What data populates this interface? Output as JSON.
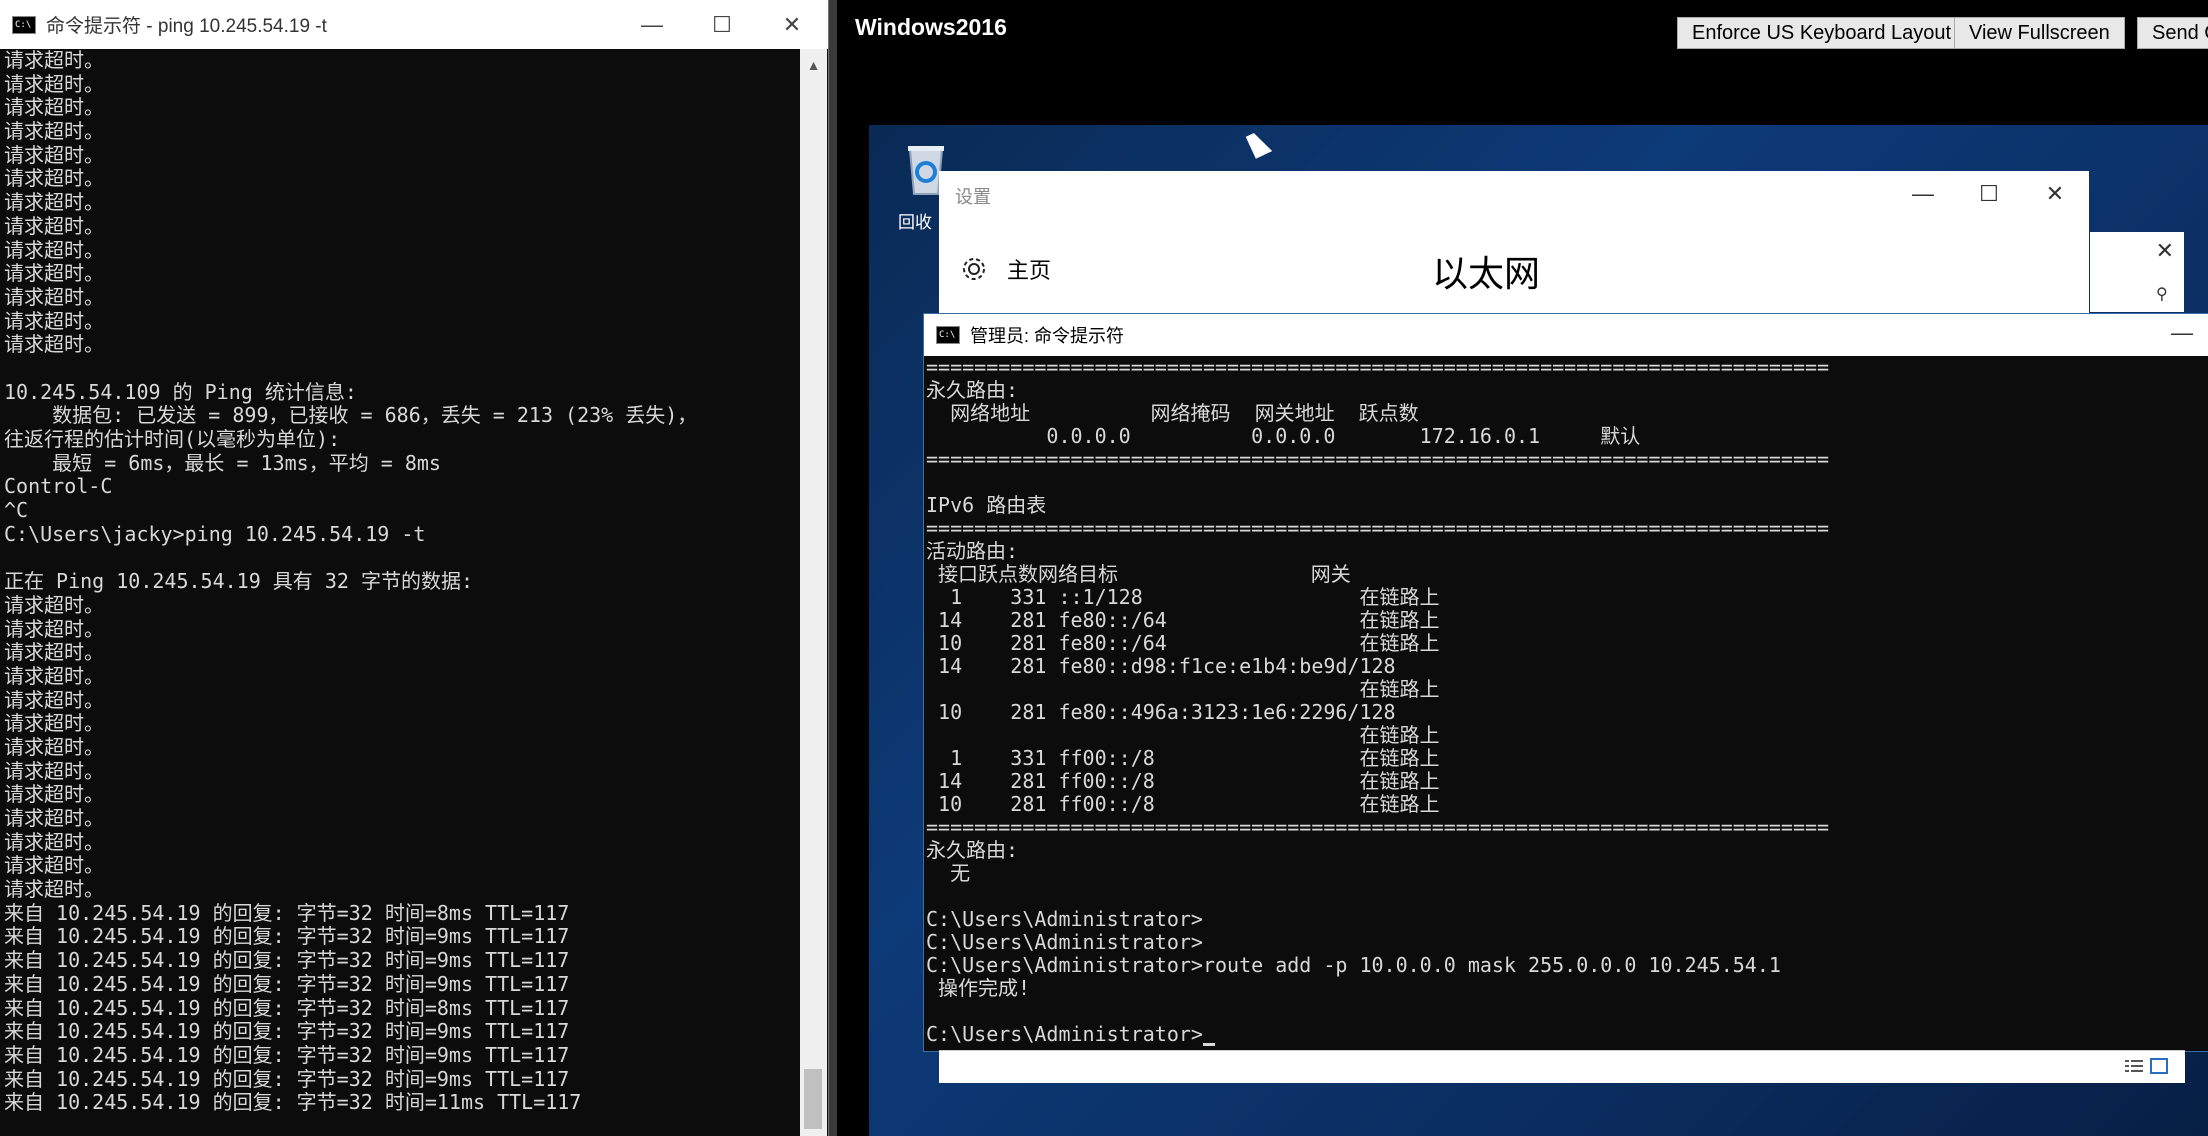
{
  "left_window": {
    "title": "命令提示符 - ping  10.245.54.19 -t",
    "icon_text": "C:\\",
    "controls": {
      "minimize": "—",
      "maximize": "☐",
      "close": "✕"
    },
    "lines": [
      "请求超时。",
      "请求超时。",
      "请求超时。",
      "请求超时。",
      "请求超时。",
      "请求超时。",
      "请求超时。",
      "请求超时。",
      "请求超时。",
      "请求超时。",
      "请求超时。",
      "请求超时。",
      "请求超时。",
      "",
      "10.245.54.109 的 Ping 统计信息:",
      "    数据包: 已发送 = 899，已接收 = 686，丢失 = 213 (23% 丢失)，",
      "往返行程的估计时间(以毫秒为单位):",
      "    最短 = 6ms，最长 = 13ms，平均 = 8ms",
      "Control-C",
      "^C",
      "C:\\Users\\jacky>ping 10.245.54.19 -t",
      "",
      "正在 Ping 10.245.54.19 具有 32 字节的数据:",
      "请求超时。",
      "请求超时。",
      "请求超时。",
      "请求超时。",
      "请求超时。",
      "请求超时。",
      "请求超时。",
      "请求超时。",
      "请求超时。",
      "请求超时。",
      "请求超时。",
      "请求超时。",
      "请求超时。",
      "来自 10.245.54.19 的回复: 字节=32 时间=8ms TTL=117",
      "来自 10.245.54.19 的回复: 字节=32 时间=9ms TTL=117",
      "来自 10.245.54.19 的回复: 字节=32 时间=9ms TTL=117",
      "来自 10.245.54.19 的回复: 字节=32 时间=9ms TTL=117",
      "来自 10.245.54.19 的回复: 字节=32 时间=8ms TTL=117",
      "来自 10.245.54.19 的回复: 字节=32 时间=9ms TTL=117",
      "来自 10.245.54.19 的回复: 字节=32 时间=9ms TTL=117",
      "来自 10.245.54.19 的回复: 字节=32 时间=9ms TTL=117",
      "来自 10.245.54.19 的回复: 字节=32 时间=11ms TTL=117"
    ],
    "scroll_up": "▲"
  },
  "rdp": {
    "title": "Windows2016",
    "buttons": [
      "Enforce US Keyboard Layout",
      "View Fullscreen",
      "Send C"
    ]
  },
  "desktop": {
    "recycle_label": "回收"
  },
  "settings_window": {
    "title": "设置",
    "controls": {
      "minimize": "—",
      "maximize": "☐",
      "close": "✕"
    },
    "home_label": "主页",
    "heading": "以太网"
  },
  "second_window": {
    "close": "✕",
    "search_icon": "⚲"
  },
  "admin_window": {
    "title": "管理员: 命令提示符",
    "minimize": "—",
    "lines": [
      "===========================================================================",
      "永久路由:",
      "  网络地址          网络掩码  网关地址  跃点数",
      "          0.0.0.0          0.0.0.0       172.16.0.1     默认",
      "===========================================================================",
      "",
      "IPv6 路由表",
      "===========================================================================",
      "活动路由:",
      " 接口跃点数网络目标                网关",
      "  1    331 ::1/128                  在链路上",
      " 14    281 fe80::/64                在链路上",
      " 10    281 fe80::/64                在链路上",
      " 14    281 fe80::d98:f1ce:e1b4:be9d/128",
      "                                    在链路上",
      " 10    281 fe80::496a:3123:1e6:2296/128",
      "                                    在链路上",
      "  1    331 ff00::/8                 在链路上",
      " 14    281 ff00::/8                 在链路上",
      " 10    281 ff00::/8                 在链路上",
      "===========================================================================",
      "永久路由:",
      "  无",
      "",
      "C:\\Users\\Administrator>",
      "C:\\Users\\Administrator>",
      "C:\\Users\\Administrator>route add -p 10.0.0.0 mask 255.0.0.0 10.245.54.1",
      " 操作完成!",
      "",
      "C:\\Users\\Administrator>"
    ]
  },
  "colors": {
    "console_bg": "#0c0c0c",
    "console_fg": "#d8d8d8",
    "desktop_blue": "#0d3a78"
  }
}
